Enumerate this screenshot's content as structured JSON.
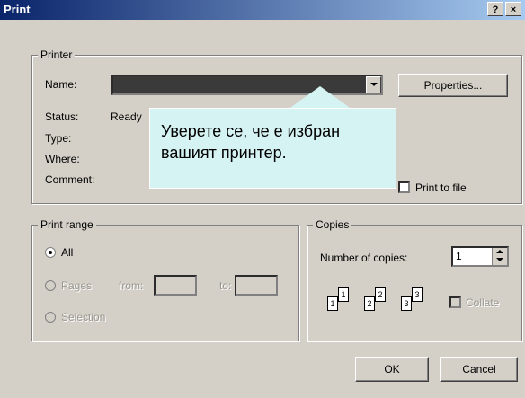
{
  "window": {
    "title": "Print",
    "help_label": "?",
    "close_label": "×"
  },
  "printer_group": {
    "legend": "Printer",
    "name_label": "Name:",
    "name_value": "",
    "properties_label": "Properties...",
    "status_label": "Status:",
    "status_value": "Ready",
    "type_label": "Type:",
    "where_label": "Where:",
    "comment_label": "Comment:",
    "print_to_file_label": "Print to file"
  },
  "callout": {
    "line1": "Уверете се, че е избран",
    "line2": "вашият принтер."
  },
  "print_range": {
    "legend": "Print range",
    "all_label": "All",
    "pages_label": "Pages",
    "from_label": "from:",
    "to_label": "to:",
    "selection_label": "Selection",
    "selected": "All"
  },
  "copies": {
    "legend": "Copies",
    "number_label": "Number of copies:",
    "number_value": "1",
    "collate_label": "Collate",
    "page_icons": [
      "1",
      "1",
      "2",
      "2",
      "3",
      "3"
    ]
  },
  "footer": {
    "ok_label": "OK",
    "cancel_label": "Cancel"
  }
}
